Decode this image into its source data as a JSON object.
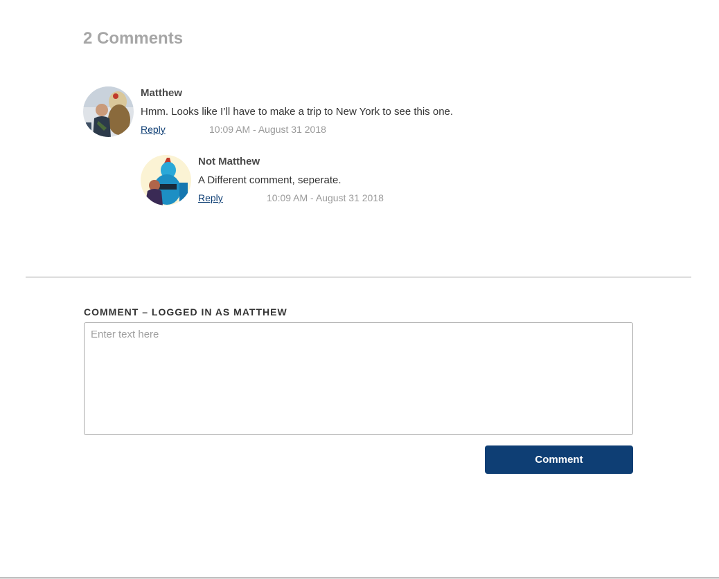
{
  "comments_section": {
    "count_title": "2 Comments",
    "comments": [
      {
        "author": "Matthew",
        "text": "Hmm. Looks like I’ll have to make a trip to New York to see this one.",
        "reply_label": "Reply",
        "timestamp": "10:09 AM - August 31 2018"
      },
      {
        "author": "Not Matthew",
        "text": "A Different comment, seperate.",
        "reply_label": "Reply",
        "timestamp": "10:09 AM - August 31 2018"
      }
    ]
  },
  "comment_form": {
    "label": "COMMENT – LOGGED IN AS MATTHEW",
    "placeholder": "Enter text here",
    "value": "",
    "submit_label": "Comment"
  },
  "colors": {
    "accent": "#0e3e74",
    "muted_text": "#a6a6a6",
    "divider": "#9b9b9b"
  }
}
